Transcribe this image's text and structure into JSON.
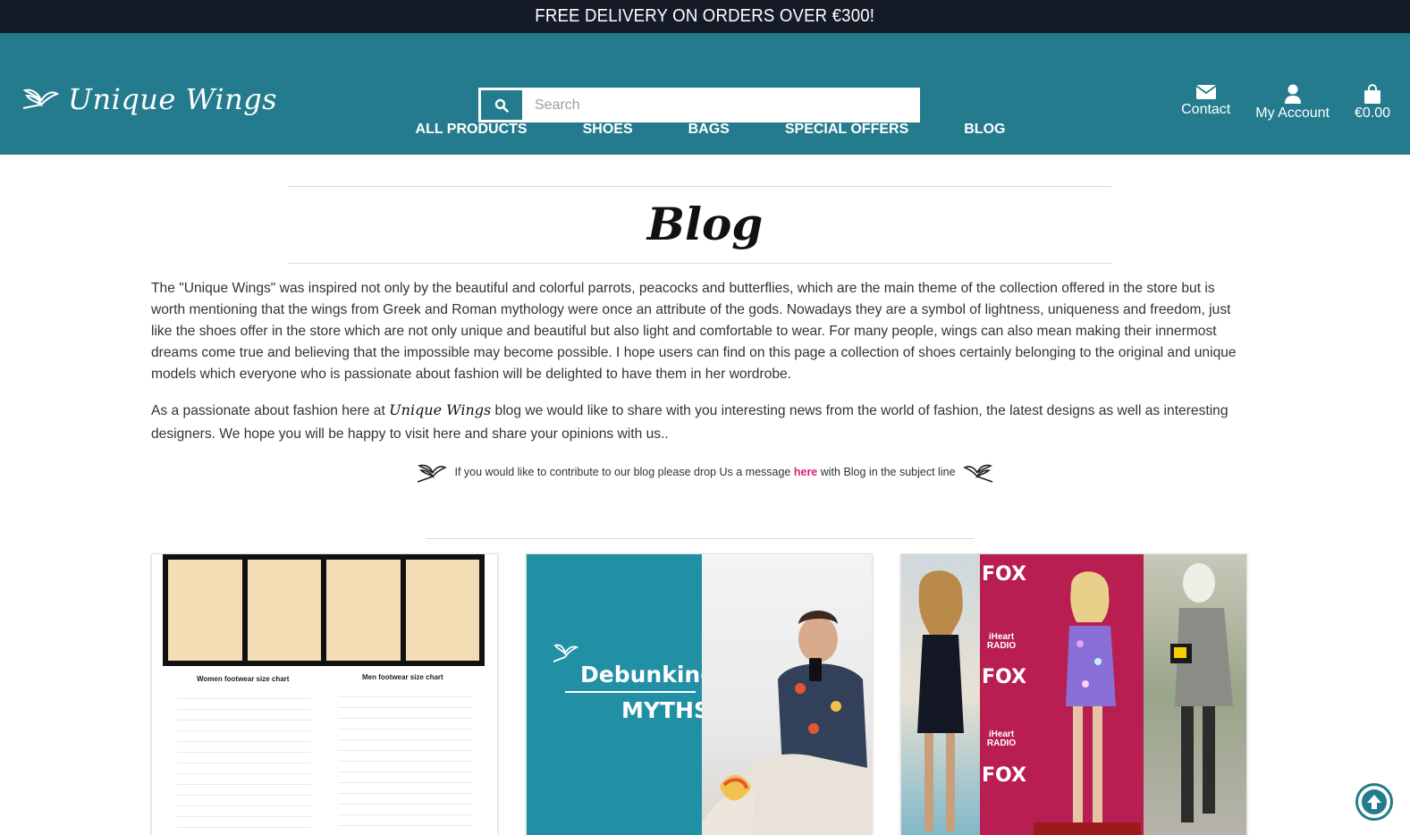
{
  "promo_banner": "FREE DELIVERY ON ORDERS OVER €300!",
  "brand": {
    "name": "Unique Wings"
  },
  "search": {
    "placeholder": "Search"
  },
  "header_links": {
    "contact": "Contact",
    "account": "My Account",
    "cart_total": "€0.00"
  },
  "nav": [
    "ALL PRODUCTS",
    "SHOES",
    "BAGS",
    "SPECIAL OFFERS",
    "BLOG"
  ],
  "page_title": "Blog",
  "intro": "The \"Unique Wings\" was inspired not only by the beautiful and colorful parrots, peacocks and butterflies, which are the main theme of the collection offered in the store but is worth mentioning that the wings from Greek and Roman mythology were once an attribute of the gods. Nowadays they are a symbol of lightness, uniqueness and freedom, just like the shoes offer in the store which are not only unique and beautiful but also light and comfortable to wear. For many people, wings can also mean making their innermost dreams come true and believing that the impossible may become possible. I hope users can find on this page a collection of shoes certainly belonging to the original and unique models which everyone who is passionate about fashion will be delighted to have them in her wordrobe.",
  "second_para": {
    "before": "As a passionate about fashion here at ",
    "brand": "Unique Wings",
    "after": " blog we would like to share with you interesting news from the world of fashion, the latest designs as well as interesting designers. We hope you will be happy to visit here and share your opinions with us.."
  },
  "contribute": {
    "before": "If you would like to contribute to our blog please drop Us a message ",
    "link": "here",
    "after": " with Blog in the subject line"
  },
  "cards": {
    "card1": {
      "women_chart": "Women footwear size chart",
      "men_chart": "Men footwear size chart"
    },
    "card2": {
      "line1": "Debunking",
      "line2": "MYTHS"
    },
    "card3": {
      "brand": "FOX",
      "radio": "iHeart RADIO"
    }
  },
  "colors": {
    "header": "#237b8d",
    "topbar": "#141b27",
    "link": "#e0207a"
  }
}
